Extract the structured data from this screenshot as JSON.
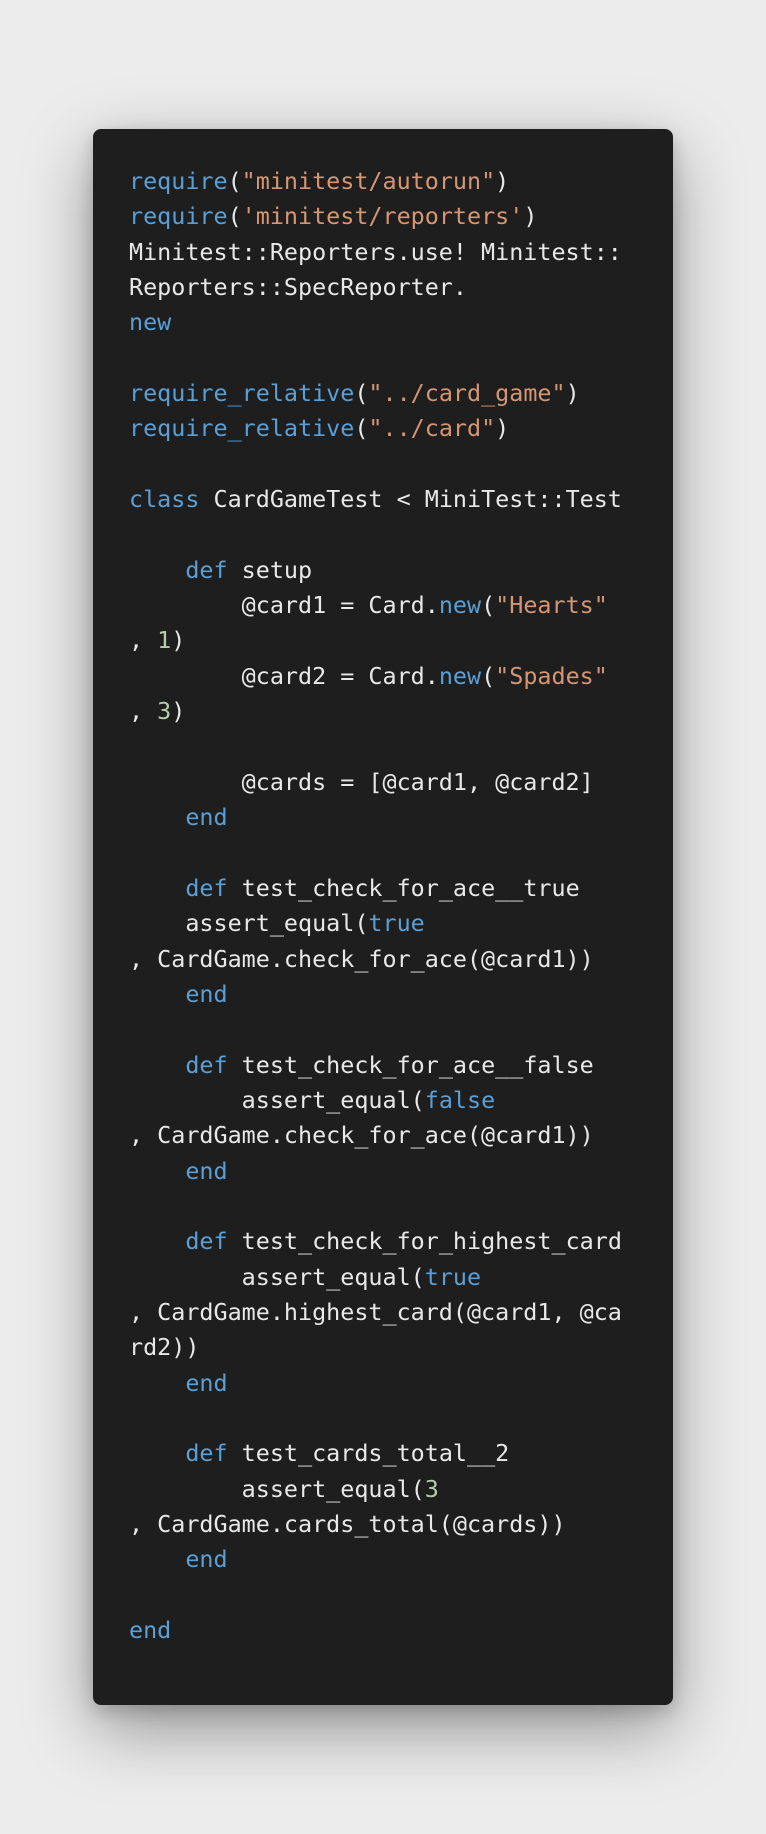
{
  "colors": {
    "background": "#ececec",
    "editor": "#1e1e1e",
    "keyword": "#5a9fd6",
    "string": "#d59674",
    "number": "#b5cea8",
    "text": "#e8e8e8"
  },
  "code_lines": [
    [
      [
        "kw",
        "require"
      ],
      [
        "txt",
        "("
      ],
      [
        "str",
        "\"minitest/autorun\""
      ],
      [
        "txt",
        ")"
      ]
    ],
    [
      [
        "kw",
        "require"
      ],
      [
        "txt",
        "("
      ],
      [
        "str",
        "'minitest/reporters'"
      ],
      [
        "txt",
        ")"
      ]
    ],
    [
      [
        "txt",
        "Minitest::Reporters.use! Minitest::"
      ]
    ],
    [
      [
        "txt",
        "Reporters::SpecReporter."
      ]
    ],
    [
      [
        "kw",
        "new"
      ]
    ],
    [],
    [
      [
        "kw",
        "require_relative"
      ],
      [
        "txt",
        "("
      ],
      [
        "str",
        "\"../card_game\""
      ],
      [
        "txt",
        ")"
      ]
    ],
    [
      [
        "kw",
        "require_relative"
      ],
      [
        "txt",
        "("
      ],
      [
        "str",
        "\"../card\""
      ],
      [
        "txt",
        ")"
      ]
    ],
    [],
    [
      [
        "kw",
        "class"
      ],
      [
        "txt",
        " CardGameTest < MiniTest::Test"
      ]
    ],
    [],
    [
      [
        "txt",
        "    "
      ],
      [
        "kw",
        "def"
      ],
      [
        "txt",
        " setup"
      ]
    ],
    [
      [
        "txt",
        "        @card1 = Card."
      ],
      [
        "kw",
        "new"
      ],
      [
        "txt",
        "("
      ],
      [
        "str",
        "\"Hearts\""
      ]
    ],
    [
      [
        "txt",
        ", "
      ],
      [
        "num",
        "1"
      ],
      [
        "txt",
        ")"
      ]
    ],
    [
      [
        "txt",
        "        @card2 = Card."
      ],
      [
        "kw",
        "new"
      ],
      [
        "txt",
        "("
      ],
      [
        "str",
        "\"Spades\""
      ]
    ],
    [
      [
        "txt",
        ", "
      ],
      [
        "num",
        "3"
      ],
      [
        "txt",
        ")"
      ]
    ],
    [],
    [
      [
        "txt",
        "        @cards = [@card1, @card2]"
      ]
    ],
    [
      [
        "txt",
        "    "
      ],
      [
        "kw",
        "end"
      ]
    ],
    [],
    [
      [
        "txt",
        "    "
      ],
      [
        "kw",
        "def"
      ],
      [
        "txt",
        " test_check_for_ace__true"
      ]
    ],
    [
      [
        "txt",
        "    assert_equal("
      ],
      [
        "kw",
        "true"
      ]
    ],
    [
      [
        "txt",
        ", CardGame.check_for_ace(@card1))"
      ]
    ],
    [
      [
        "txt",
        "    "
      ],
      [
        "kw",
        "end"
      ]
    ],
    [],
    [
      [
        "txt",
        "    "
      ],
      [
        "kw",
        "def"
      ],
      [
        "txt",
        " test_check_for_ace__false"
      ]
    ],
    [
      [
        "txt",
        "        assert_equal("
      ],
      [
        "kw",
        "false"
      ]
    ],
    [
      [
        "txt",
        ", CardGame.check_for_ace(@card1))"
      ]
    ],
    [
      [
        "txt",
        "    "
      ],
      [
        "kw",
        "end"
      ]
    ],
    [],
    [
      [
        "txt",
        "    "
      ],
      [
        "kw",
        "def"
      ],
      [
        "txt",
        " test_check_for_highest_card"
      ]
    ],
    [
      [
        "txt",
        "        assert_equal("
      ],
      [
        "kw",
        "true"
      ]
    ],
    [
      [
        "txt",
        ", CardGame.highest_card(@card1, @ca"
      ]
    ],
    [
      [
        "txt",
        "rd2))"
      ]
    ],
    [
      [
        "txt",
        "    "
      ],
      [
        "kw",
        "end"
      ]
    ],
    [],
    [
      [
        "txt",
        "    "
      ],
      [
        "kw",
        "def"
      ],
      [
        "txt",
        " test_cards_total__2"
      ]
    ],
    [
      [
        "txt",
        "        assert_equal("
      ],
      [
        "num",
        "3"
      ]
    ],
    [
      [
        "txt",
        ", CardGame.cards_total(@cards))"
      ]
    ],
    [
      [
        "txt",
        "    "
      ],
      [
        "kw",
        "end"
      ]
    ],
    [],
    [
      [
        "kw",
        "end"
      ]
    ]
  ]
}
